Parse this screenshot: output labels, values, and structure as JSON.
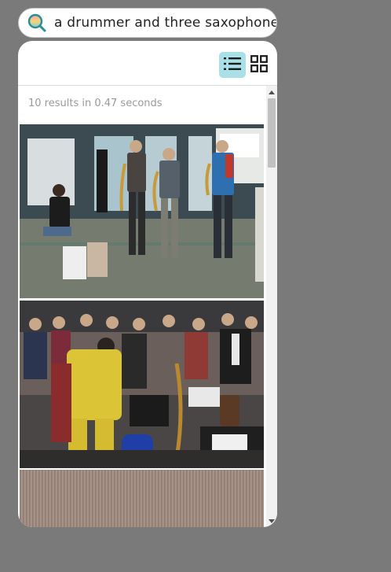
{
  "search": {
    "query": "a drummer and three saxophones",
    "icon": "search-icon"
  },
  "toolbar": {
    "list_view_icon": "list-view-icon",
    "grid_view_icon": "grid-view-icon",
    "active_view": "list"
  },
  "results": {
    "summary": "10 results in 0.47 seconds",
    "items": [
      {
        "kind": "photo",
        "subject": "street-band"
      },
      {
        "kind": "photo",
        "subject": "crowd-band"
      },
      {
        "kind": "photo",
        "subject": "wood-texture"
      }
    ]
  },
  "colors": {
    "background": "#7a7a7a",
    "active_toggle": "#a9dfe6",
    "summary_text": "#9a9a9a"
  }
}
